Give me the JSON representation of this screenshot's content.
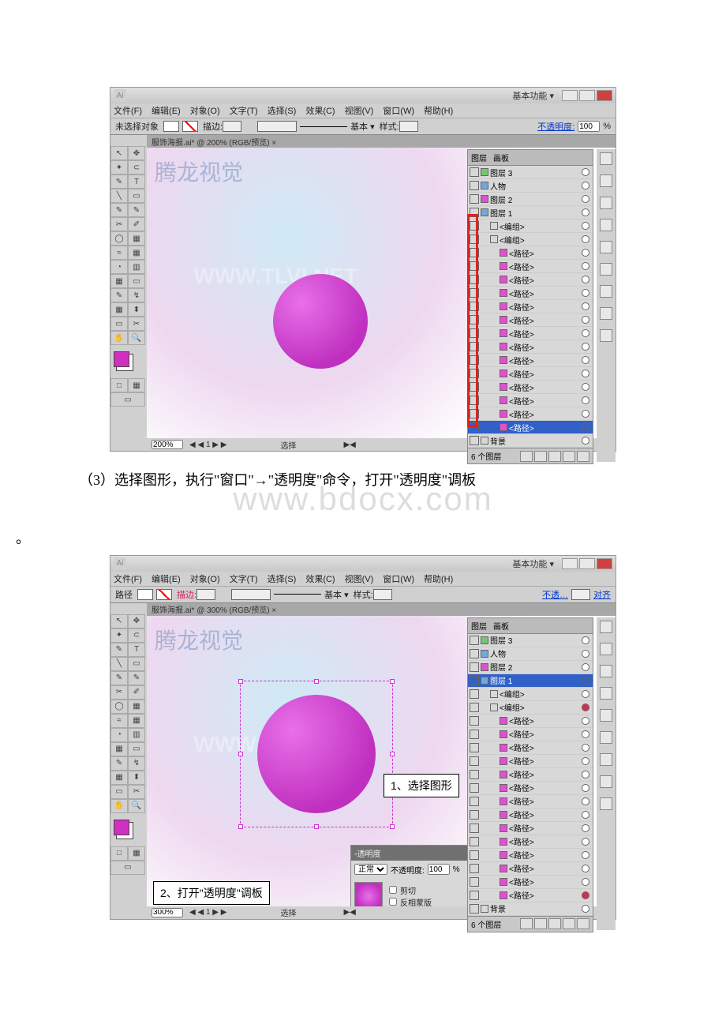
{
  "titlebar": {
    "logo": "Ai",
    "workspace": "基本功能 ▾"
  },
  "window_controls": {
    "min": "—",
    "max": "□",
    "close": "×"
  },
  "menubar": [
    "文件(F)",
    "编辑(E)",
    "对象(O)",
    "文字(T)",
    "选择(S)",
    "效果(C)",
    "视图(V)",
    "窗口(W)",
    "帮助(H)"
  ],
  "optbar1": {
    "left": "未选择对象",
    "stroke_label": "描边:",
    "base_label": "基本 ▾",
    "style_label": "样式:",
    "opacity_link": "不透明度:",
    "opacity_val": "100",
    "pct": "%"
  },
  "optbar2": {
    "left": "路径",
    "stroke_label": "描边:",
    "base_label": "基本 ▾",
    "style_label": "样式:",
    "opacity_link": "不透…",
    "align_link": "对齐"
  },
  "tab1": "服饰海报.ai* @ 200% (RGB/预览) ×",
  "tab2": "服饰海报.ai* @ 300% (RGB/预览) ×",
  "tools": [
    [
      "↖",
      "✥"
    ],
    [
      "✒",
      "✦"
    ],
    [
      "✎",
      "T"
    ],
    [
      "╲",
      "▭"
    ],
    [
      "✎",
      "✎"
    ],
    [
      "✂",
      "✐"
    ],
    [
      "◯",
      "▦"
    ],
    [
      "≈",
      "▦"
    ],
    [
      "◔",
      "▥"
    ],
    [
      "▦",
      "▭"
    ],
    [
      "✎",
      "↯"
    ],
    [
      "▦",
      "⬍"
    ],
    [
      "▭",
      "✂"
    ],
    [
      "✋",
      "🔍"
    ]
  ],
  "status1": {
    "zoom": "200%",
    "nav": "◀ ◀ 1 ▶ ▶",
    "mode": "选择",
    "play": "▶◀"
  },
  "status2": {
    "zoom": "300%",
    "nav": "◀ ◀ 1 ▶ ▶",
    "mode": "选择",
    "play": "▶◀"
  },
  "panel": {
    "tabs": [
      "图层",
      "画板"
    ],
    "items_top1": [
      {
        "name": "图层 3",
        "sw": "green"
      },
      {
        "name": "人物",
        "sw": "blue"
      },
      {
        "name": "图层 2",
        "sw": "pink"
      },
      {
        "name": "图层 1",
        "sw": "blue"
      }
    ],
    "items_top2": [
      {
        "name": "图层 3",
        "sw": "green"
      },
      {
        "name": "人物",
        "sw": "blue"
      },
      {
        "name": "图层 2",
        "sw": "pink"
      },
      {
        "name": "图层 1",
        "sw": "blue",
        "sel": true
      }
    ],
    "group1": "<编组>",
    "group2": "<编组>",
    "path": "<路径>",
    "bg": "背景",
    "foot": "6 个图层"
  },
  "caption": "（3）选择图形，执行\"窗口\"→\"透明度\"命令，打开\"透明度\"调板",
  "period": "。",
  "wm_big": "www.bdocx.com",
  "brand": "腾龙视觉",
  "wm_canvas": "WWW.TLVI.NET",
  "callouts": {
    "c1": "1、选择图形",
    "c2": "2、打开\"透明度\"调板"
  },
  "transparency": {
    "title": "◦透明度",
    "mode": "正常",
    "opacity_label": "不透明度:",
    "opacity_val": "100",
    "pct": "%",
    "chk1": "剪切",
    "chk2": "反相蒙版"
  }
}
